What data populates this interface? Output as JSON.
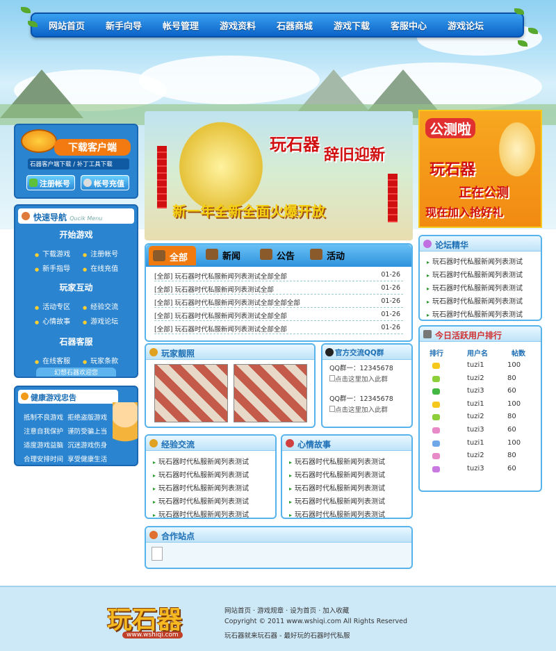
{
  "nav": [
    "网站首页",
    "新手向导",
    "帐号管理",
    "游戏资料",
    "石器商城",
    "游戏下载",
    "客服中心",
    "游戏论坛"
  ],
  "download": {
    "title": "下载客户端",
    "sub": "石器客户端下载 / 补丁工具下载",
    "reg": "注册帐号",
    "pay": "帐号充值"
  },
  "quicknav": {
    "title": "快速导航",
    "en": "Qucik Menu",
    "sec1": "开始游戏",
    "s1": [
      "下载游戏",
      "注册帐号",
      "新手指导",
      "在线充值"
    ],
    "sec2": "玩家互动",
    "s2": [
      "活动专区",
      "经验交流",
      "心情故事",
      "游戏论坛"
    ],
    "sec3": "石器客服",
    "s3": [
      "在线客服",
      "玩家条款"
    ],
    "welcome": "幻想石器欢迎您"
  },
  "health": {
    "title": "健康游戏忠告",
    "lines": [
      "抵制不良游戏",
      "拒绝盗版游戏",
      "注意自我保护",
      "谨防受骗上当",
      "适度游戏益脑",
      "沉迷游戏伤身",
      "合理安排时间",
      "享受健康生活"
    ]
  },
  "banner": {
    "title": "玩石器",
    "title2": "辞旧迎新",
    "slogan": "新一年全新全面火爆开放"
  },
  "news": {
    "tabs": [
      "全部",
      "新闻",
      "公告",
      "活动"
    ],
    "rows": [
      {
        "t": "[全部] 玩石器时代私服新闻列表测试全部全部",
        "d": "01-26"
      },
      {
        "t": "[全部] 玩石器时代私服新闻列表测试全部",
        "d": "01-26"
      },
      {
        "t": "[全部] 玩石器时代私服新闻列表测试全部全部全部",
        "d": "01-26"
      },
      {
        "t": "[全部] 玩石器时代私服新闻列表测试全部全部",
        "d": "01-26"
      },
      {
        "t": "[全部] 玩石器时代私服新闻列表测试全部全部",
        "d": "01-26"
      }
    ]
  },
  "promo": {
    "t1": "公测啦",
    "t2": "玩石器",
    "t3": "正在公测",
    "t4": "现在加入抢好礼"
  },
  "forum": {
    "title": "论坛精华",
    "items": [
      "玩石器时代私服新闻列表测试",
      "玩石器时代私服新闻列表测试",
      "玩石器时代私服新闻列表测试",
      "玩石器时代私服新闻列表测试",
      "玩石器时代私服新闻列表测试"
    ]
  },
  "photos": {
    "title": "玩家靓照"
  },
  "qq": {
    "title": "官方交流QQ群",
    "g1": "QQ群一：12345678",
    "g2": "QQ群一：12345678",
    "join": "点击这里加入此群"
  },
  "exp": {
    "title": "经验交流",
    "items": [
      "玩石器时代私服新闻列表测试",
      "玩石器时代私服新闻列表测试",
      "玩石器时代私服新闻列表测试",
      "玩石器时代私服新闻列表测试",
      "玩石器时代私服新闻列表测试"
    ]
  },
  "story": {
    "title": "心情故事",
    "items": [
      "玩石器时代私服新闻列表测试",
      "玩石器时代私服新闻列表测试",
      "玩石器时代私服新闻列表测试",
      "玩石器时代私服新闻列表测试",
      "玩石器时代私服新闻列表测试"
    ]
  },
  "partners": {
    "title": "合作站点"
  },
  "ranking": {
    "title": "今日活跃用户排行",
    "cols": [
      "排行",
      "用户名",
      "帖数"
    ],
    "rows": [
      [
        "tuzi1",
        "100"
      ],
      [
        "tuzi2",
        "80"
      ],
      [
        "tuzi3",
        "60"
      ],
      [
        "tuzi1",
        "100"
      ],
      [
        "tuzi2",
        "80"
      ],
      [
        "tuzi3",
        "60"
      ],
      [
        "tuzi1",
        "100"
      ],
      [
        "tuzi2",
        "80"
      ],
      [
        "tuzi3",
        "60"
      ]
    ],
    "colors": [
      "#f7c81c",
      "#8ccf3a",
      "#43b843",
      "#f7c81c",
      "#8ccf3a",
      "#e88ac8",
      "#6fa8e8",
      "#e88ac8",
      "#c97ae0"
    ]
  },
  "footer": {
    "logo": "玩石器",
    "url": "www.wshiqi.com",
    "links": [
      "网站首页",
      "游戏规章",
      "设为首页",
      "加入收藏"
    ],
    "copy": "Copyright © 2011 www.wshiqi.com All Rights Reserved",
    "desc": "玩石器就来玩石器 - 最好玩的石器时代私服"
  }
}
